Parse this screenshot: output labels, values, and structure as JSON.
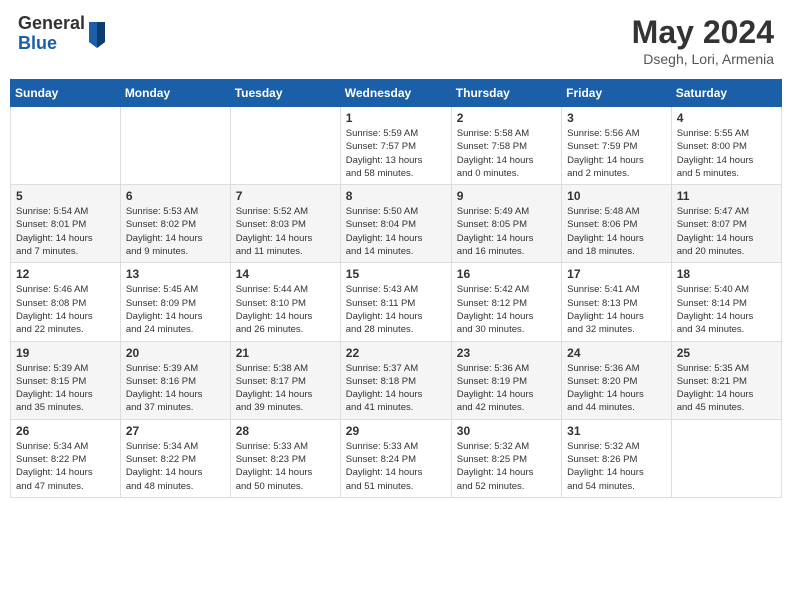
{
  "header": {
    "logo_general": "General",
    "logo_blue": "Blue",
    "month_title": "May 2024",
    "location": "Dsegh, Lori, Armenia"
  },
  "weekdays": [
    "Sunday",
    "Monday",
    "Tuesday",
    "Wednesday",
    "Thursday",
    "Friday",
    "Saturday"
  ],
  "weeks": [
    [
      {
        "day": "",
        "info": ""
      },
      {
        "day": "",
        "info": ""
      },
      {
        "day": "",
        "info": ""
      },
      {
        "day": "1",
        "info": "Sunrise: 5:59 AM\nSunset: 7:57 PM\nDaylight: 13 hours\nand 58 minutes."
      },
      {
        "day": "2",
        "info": "Sunrise: 5:58 AM\nSunset: 7:58 PM\nDaylight: 14 hours\nand 0 minutes."
      },
      {
        "day": "3",
        "info": "Sunrise: 5:56 AM\nSunset: 7:59 PM\nDaylight: 14 hours\nand 2 minutes."
      },
      {
        "day": "4",
        "info": "Sunrise: 5:55 AM\nSunset: 8:00 PM\nDaylight: 14 hours\nand 5 minutes."
      }
    ],
    [
      {
        "day": "5",
        "info": "Sunrise: 5:54 AM\nSunset: 8:01 PM\nDaylight: 14 hours\nand 7 minutes."
      },
      {
        "day": "6",
        "info": "Sunrise: 5:53 AM\nSunset: 8:02 PM\nDaylight: 14 hours\nand 9 minutes."
      },
      {
        "day": "7",
        "info": "Sunrise: 5:52 AM\nSunset: 8:03 PM\nDaylight: 14 hours\nand 11 minutes."
      },
      {
        "day": "8",
        "info": "Sunrise: 5:50 AM\nSunset: 8:04 PM\nDaylight: 14 hours\nand 14 minutes."
      },
      {
        "day": "9",
        "info": "Sunrise: 5:49 AM\nSunset: 8:05 PM\nDaylight: 14 hours\nand 16 minutes."
      },
      {
        "day": "10",
        "info": "Sunrise: 5:48 AM\nSunset: 8:06 PM\nDaylight: 14 hours\nand 18 minutes."
      },
      {
        "day": "11",
        "info": "Sunrise: 5:47 AM\nSunset: 8:07 PM\nDaylight: 14 hours\nand 20 minutes."
      }
    ],
    [
      {
        "day": "12",
        "info": "Sunrise: 5:46 AM\nSunset: 8:08 PM\nDaylight: 14 hours\nand 22 minutes."
      },
      {
        "day": "13",
        "info": "Sunrise: 5:45 AM\nSunset: 8:09 PM\nDaylight: 14 hours\nand 24 minutes."
      },
      {
        "day": "14",
        "info": "Sunrise: 5:44 AM\nSunset: 8:10 PM\nDaylight: 14 hours\nand 26 minutes."
      },
      {
        "day": "15",
        "info": "Sunrise: 5:43 AM\nSunset: 8:11 PM\nDaylight: 14 hours\nand 28 minutes."
      },
      {
        "day": "16",
        "info": "Sunrise: 5:42 AM\nSunset: 8:12 PM\nDaylight: 14 hours\nand 30 minutes."
      },
      {
        "day": "17",
        "info": "Sunrise: 5:41 AM\nSunset: 8:13 PM\nDaylight: 14 hours\nand 32 minutes."
      },
      {
        "day": "18",
        "info": "Sunrise: 5:40 AM\nSunset: 8:14 PM\nDaylight: 14 hours\nand 34 minutes."
      }
    ],
    [
      {
        "day": "19",
        "info": "Sunrise: 5:39 AM\nSunset: 8:15 PM\nDaylight: 14 hours\nand 35 minutes."
      },
      {
        "day": "20",
        "info": "Sunrise: 5:39 AM\nSunset: 8:16 PM\nDaylight: 14 hours\nand 37 minutes."
      },
      {
        "day": "21",
        "info": "Sunrise: 5:38 AM\nSunset: 8:17 PM\nDaylight: 14 hours\nand 39 minutes."
      },
      {
        "day": "22",
        "info": "Sunrise: 5:37 AM\nSunset: 8:18 PM\nDaylight: 14 hours\nand 41 minutes."
      },
      {
        "day": "23",
        "info": "Sunrise: 5:36 AM\nSunset: 8:19 PM\nDaylight: 14 hours\nand 42 minutes."
      },
      {
        "day": "24",
        "info": "Sunrise: 5:36 AM\nSunset: 8:20 PM\nDaylight: 14 hours\nand 44 minutes."
      },
      {
        "day": "25",
        "info": "Sunrise: 5:35 AM\nSunset: 8:21 PM\nDaylight: 14 hours\nand 45 minutes."
      }
    ],
    [
      {
        "day": "26",
        "info": "Sunrise: 5:34 AM\nSunset: 8:22 PM\nDaylight: 14 hours\nand 47 minutes."
      },
      {
        "day": "27",
        "info": "Sunrise: 5:34 AM\nSunset: 8:22 PM\nDaylight: 14 hours\nand 48 minutes."
      },
      {
        "day": "28",
        "info": "Sunrise: 5:33 AM\nSunset: 8:23 PM\nDaylight: 14 hours\nand 50 minutes."
      },
      {
        "day": "29",
        "info": "Sunrise: 5:33 AM\nSunset: 8:24 PM\nDaylight: 14 hours\nand 51 minutes."
      },
      {
        "day": "30",
        "info": "Sunrise: 5:32 AM\nSunset: 8:25 PM\nDaylight: 14 hours\nand 52 minutes."
      },
      {
        "day": "31",
        "info": "Sunrise: 5:32 AM\nSunset: 8:26 PM\nDaylight: 14 hours\nand 54 minutes."
      },
      {
        "day": "",
        "info": ""
      }
    ]
  ]
}
